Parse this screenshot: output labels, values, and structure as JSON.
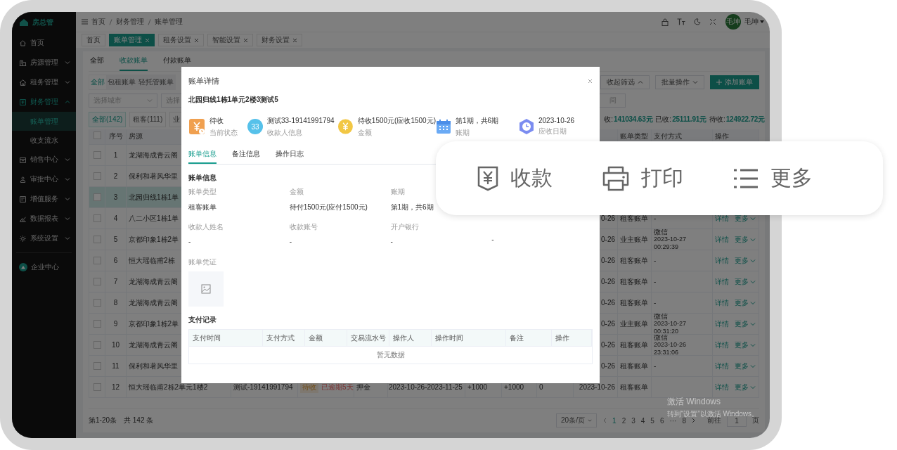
{
  "sidebar": {
    "logo": "房总管",
    "items": [
      {
        "label": "首页",
        "selected": false
      },
      {
        "label": "房源管理",
        "selected": false,
        "expanded": false
      },
      {
        "label": "租务管理",
        "selected": false,
        "expanded": false
      },
      {
        "label": "财务管理",
        "selected": true,
        "expanded": true,
        "children": [
          {
            "label": "账单管理",
            "selected": true
          },
          {
            "label": "收支流水",
            "selected": false
          }
        ]
      },
      {
        "label": "销售中心",
        "selected": false,
        "expanded": false
      },
      {
        "label": "审批中心",
        "selected": false,
        "expanded": false
      },
      {
        "label": "增值服务",
        "selected": false,
        "expanded": false
      },
      {
        "label": "数据报表",
        "selected": false,
        "expanded": false
      },
      {
        "label": "系统设置",
        "selected": false,
        "expanded": false
      }
    ],
    "footer_items": [
      {
        "label": "企业中心",
        "selected": false
      }
    ]
  },
  "breadcrumb": [
    "首页",
    "财务管理",
    "账单管理"
  ],
  "user": {
    "avatar_text": "毛坤",
    "name": "毛坤"
  },
  "tags": [
    {
      "label": "首页",
      "selected": false,
      "closable": false
    },
    {
      "label": "账单管理",
      "selected": true,
      "closable": true
    },
    {
      "label": "租务设置",
      "selected": false,
      "closable": true
    },
    {
      "label": "智能设置",
      "selected": false,
      "closable": true
    },
    {
      "label": "财务设置",
      "selected": false,
      "closable": true
    }
  ],
  "tabs": [
    {
      "label": "全部",
      "selected": false
    },
    {
      "label": "收款账单",
      "selected": true
    },
    {
      "label": "付款账单",
      "selected": false
    }
  ],
  "sub_tabs": [
    {
      "label": "全部",
      "selected": true
    },
    {
      "label": "包租账单",
      "selected": false
    },
    {
      "label": "轻托管账单",
      "selected": false
    }
  ],
  "toolbar": {
    "collapse": "收起筛选",
    "batch": "批量操作",
    "add": "添加账单"
  },
  "filters": {
    "city": "选择城市",
    "store": "选择",
    "time": "间"
  },
  "status_filters": [
    {
      "label": "全部(142)",
      "selected": true
    },
    {
      "label": "租客(111)",
      "selected": false
    },
    {
      "label": "业",
      "selected": false
    }
  ],
  "totals": [
    {
      "label": "收:",
      "value": "141034.63元"
    },
    {
      "label": "已收:",
      "value": "25111.91元"
    },
    {
      "label": "待收:",
      "value": "124922.72元"
    }
  ],
  "table": {
    "header_checked": false,
    "header": {
      "index": "序号",
      "property": "房源",
      "bill_type": "账单类型",
      "payment": "支付方式",
      "actions": "操作"
    },
    "rows": [
      {
        "index": "1",
        "property": "龙湖海成青云阁",
        "checked": false,
        "selected": false
      },
      {
        "index": "2",
        "property": "保利和著风华里",
        "checked": false,
        "selected": false
      },
      {
        "index": "3",
        "property": "北园归线1栋1单",
        "checked": false,
        "selected": true
      },
      {
        "index": "4",
        "property": "八二小区1栋1单",
        "checked": false,
        "selected": false,
        "date": "0-26",
        "bill_type": "租客账单",
        "payment_method": "-",
        "actions": [
          "详情",
          "更多"
        ]
      },
      {
        "index": "5",
        "property": "京都印象1栋2单",
        "checked": false,
        "selected": false,
        "date": "0-26",
        "bill_type": "业主账单",
        "payment_method": "微信",
        "payment_time": "2023-10-27 00:29:39",
        "actions": [
          "详情",
          "更多"
        ]
      },
      {
        "index": "6",
        "property": "恒大瑶临甫2栋",
        "checked": false,
        "selected": false,
        "date": "0-26",
        "bill_type": "租客账单",
        "payment_method": "-",
        "actions": [
          "详情",
          "更多"
        ]
      },
      {
        "index": "7",
        "property": "龙湖海成青云阁",
        "checked": false,
        "selected": false,
        "date": "0-26",
        "bill_type": "租客账单",
        "payment_method": "-",
        "actions": [
          "详情",
          "更多"
        ]
      },
      {
        "index": "8",
        "property": "龙湖海成青云阁",
        "checked": false,
        "selected": false,
        "date": "0-26",
        "bill_type": "租客账单",
        "payment_method": "-",
        "actions": [
          "详情",
          "更多"
        ]
      },
      {
        "index": "9",
        "property": "京都印象1栋2单",
        "checked": false,
        "selected": false,
        "date": "0-26",
        "bill_type": "业主账单",
        "payment_method": "微信",
        "payment_time": "2023-10-27 00:31:20",
        "actions": [
          "详情",
          "更多"
        ]
      },
      {
        "index": "10",
        "property": "龙湖海成青云阁",
        "checked": false,
        "selected": false,
        "date": "0-26",
        "bill_type": "租客账单",
        "payment_method": "微信",
        "payment_time": "2023-10-26 23:31:06",
        "actions": [
          "详情",
          "更多"
        ]
      },
      {
        "index": "11",
        "property": "保利和著风华里",
        "checked": false,
        "selected": false,
        "date": "0-26",
        "bill_type": "租客账单",
        "payment_method": "-",
        "actions": [
          "详情",
          "更多"
        ]
      },
      {
        "index": "12",
        "property": "恒大瑶临甫2栋2单元1楼2",
        "checked": false,
        "selected": false,
        "payee": "测试-19141991794",
        "status_tag": "待收",
        "overdue": "已逾期5天",
        "type": "押金",
        "period": "2023-10-26-2023-11-25",
        "amount": "+1000",
        "received": "+1000",
        "pending": "0",
        "date": "2023-10-26",
        "bill_type": "租客账单",
        "actions": [
          "详情",
          "更多"
        ]
      }
    ]
  },
  "footer": {
    "range": "第1-20条",
    "count": "共 142 条"
  },
  "pagination": {
    "size": "20条/页",
    "pages": [
      {
        "label": "1",
        "selected": true
      },
      {
        "label": "2",
        "selected": false
      },
      {
        "label": "3",
        "selected": false
      },
      {
        "label": "4",
        "selected": false
      },
      {
        "label": "5",
        "selected": false
      },
      {
        "label": "6",
        "selected": false
      },
      {
        "label": "···",
        "selected": false
      },
      {
        "label": "8",
        "selected": false
      }
    ],
    "goto_label": "前往",
    "goto_value": "1",
    "page_unit": "页"
  },
  "os_notice": {
    "title": "激活 Windows",
    "subtitle": "转到“设置”以激活 Windows。"
  },
  "modal": {
    "title": "账单详情",
    "subtitle": "北园归线1栋1单元2楼3测试5",
    "stats": [
      {
        "value": "待收",
        "label": "当前状态"
      },
      {
        "value": "测试33-19141991794",
        "label": "收款人信息",
        "avatar_text": "33"
      },
      {
        "value": "待收1500元(应收1500元)",
        "label": "金额"
      },
      {
        "value": "第1期，共6期",
        "label": "账期"
      },
      {
        "value": "2023-10-26",
        "label": "应收日期"
      }
    ],
    "tabs": [
      {
        "label": "账单信息",
        "selected": true
      },
      {
        "label": "备注信息",
        "selected": false
      },
      {
        "label": "操作日志",
        "selected": false
      }
    ],
    "section": "账单信息",
    "field_rows": [
      [
        {
          "label": "账单类型",
          "value": "租客账单"
        },
        {
          "label": "金额",
          "value": "待付1500元(应付1500元)"
        },
        {
          "label": "账期",
          "value": "第1期，共6期"
        }
      ],
      [
        {
          "label": "收款人姓名",
          "value": "-"
        },
        {
          "label": "收款账号",
          "value": "-"
        },
        {
          "label": "开户银行",
          "value": "-"
        },
        {
          "value": "-"
        }
      ]
    ],
    "voucher_label": "账单凭证",
    "payments_title": "支付记录",
    "payment_columns": [
      "支付时间",
      "支付方式",
      "金额",
      "交易流水号",
      "操作人",
      "操作时间",
      "备注",
      "操作"
    ],
    "empty_text": "暂无数据"
  },
  "callout": {
    "actions": [
      {
        "label": "收款"
      },
      {
        "label": "打印"
      },
      {
        "label": "更多"
      }
    ]
  }
}
